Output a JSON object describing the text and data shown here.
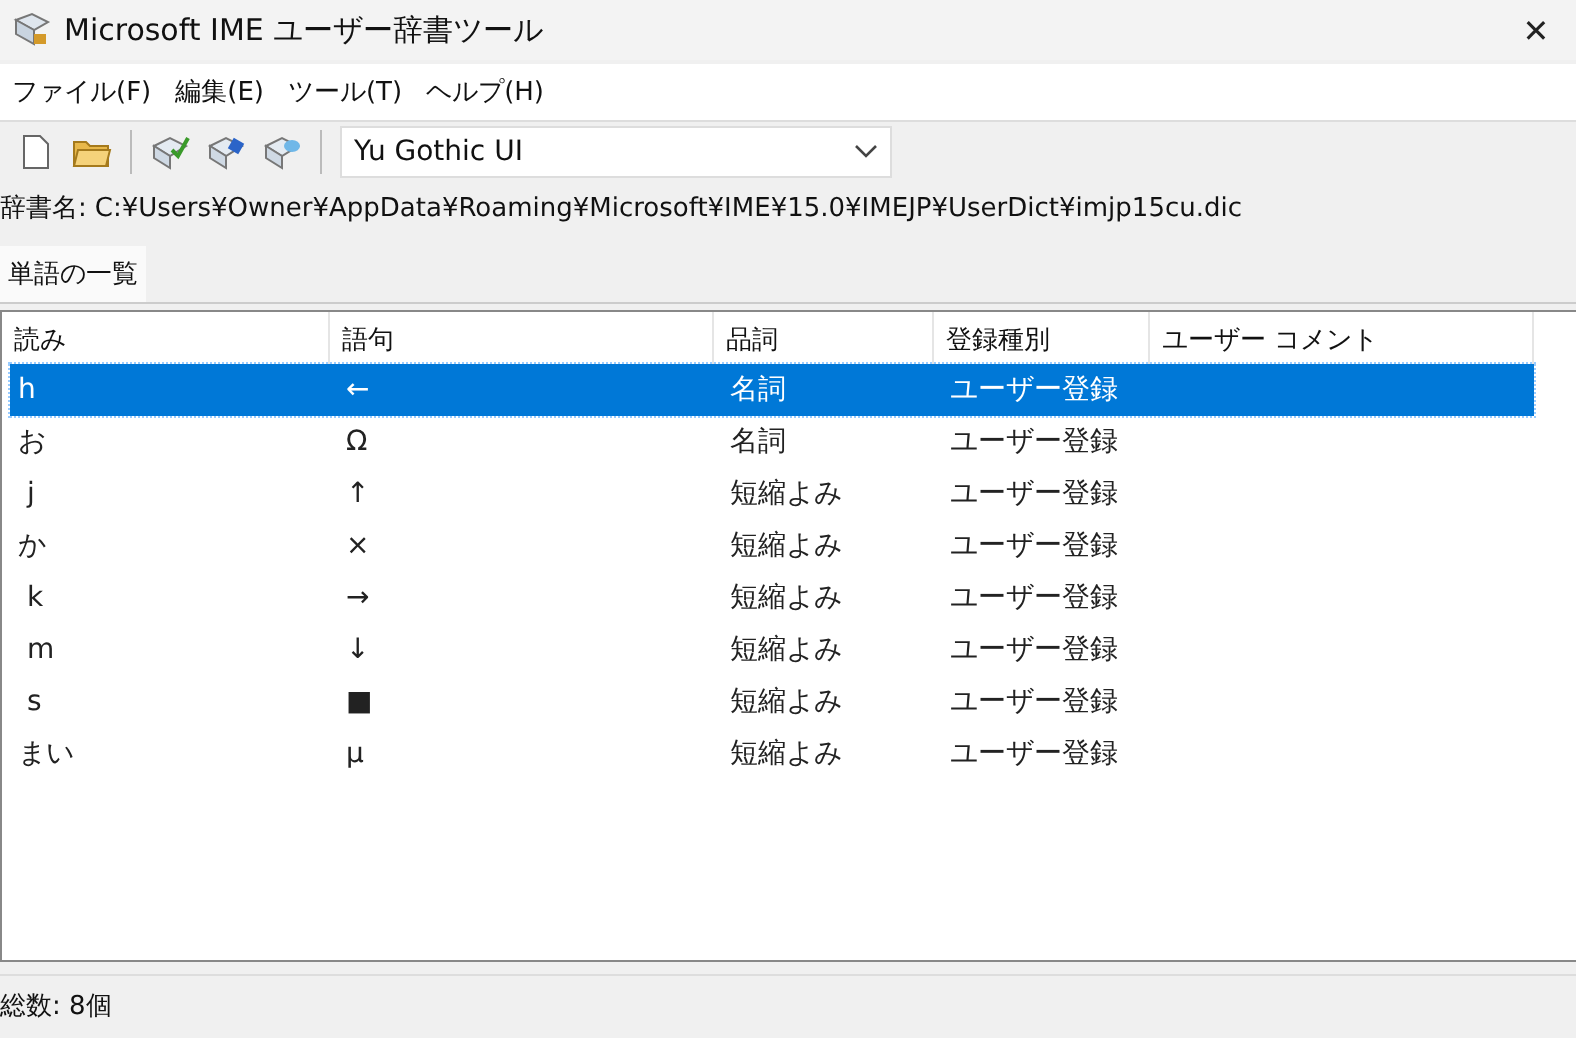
{
  "window": {
    "title": "Microsoft IME ユーザー辞書ツール",
    "close": "✕"
  },
  "menu": [
    "ファイル(F)",
    "編集(E)",
    "ツール(T)",
    "ヘルプ(H)"
  ],
  "toolbar": {
    "font": "Yu Gothic UI"
  },
  "dictionary": {
    "label": "辞書名:",
    "path": "C:¥Users¥Owner¥AppData¥Roaming¥Microsoft¥IME¥15.0¥IMEJP¥UserDict¥imjp15cu.dic"
  },
  "tabs": [
    {
      "label": "単語の一覧",
      "selected": true
    }
  ],
  "table": {
    "columns": [
      "読み",
      "語句",
      "品詞",
      "登録種別",
      "ユーザー コメント"
    ],
    "rows": [
      {
        "cells": [
          "h",
          "←",
          "名詞",
          "ユーザー登録"
        ],
        "selected": true
      },
      {
        "cells": [
          "お",
          "Ω",
          "名詞",
          "ユーザー登録"
        ],
        "selected": false
      },
      {
        "cells": [
          " j",
          "↑",
          "短縮よみ",
          "ユーザー登録"
        ],
        "selected": false
      },
      {
        "cells": [
          "か",
          "×",
          "短縮よみ",
          "ユーザー登録"
        ],
        "selected": false
      },
      {
        "cells": [
          " k",
          "→",
          "短縮よみ",
          "ユーザー登録"
        ],
        "selected": false
      },
      {
        "cells": [
          " m",
          "↓",
          "短縮よみ",
          "ユーザー登録"
        ],
        "selected": false
      },
      {
        "cells": [
          " s",
          "■",
          "短縮よみ",
          "ユーザー登録"
        ],
        "selected": false
      },
      {
        "cells": [
          "まい",
          "μ",
          "短縮よみ",
          "ユーザー登録"
        ],
        "selected": false
      }
    ]
  },
  "status_bar": "総数: 8個"
}
